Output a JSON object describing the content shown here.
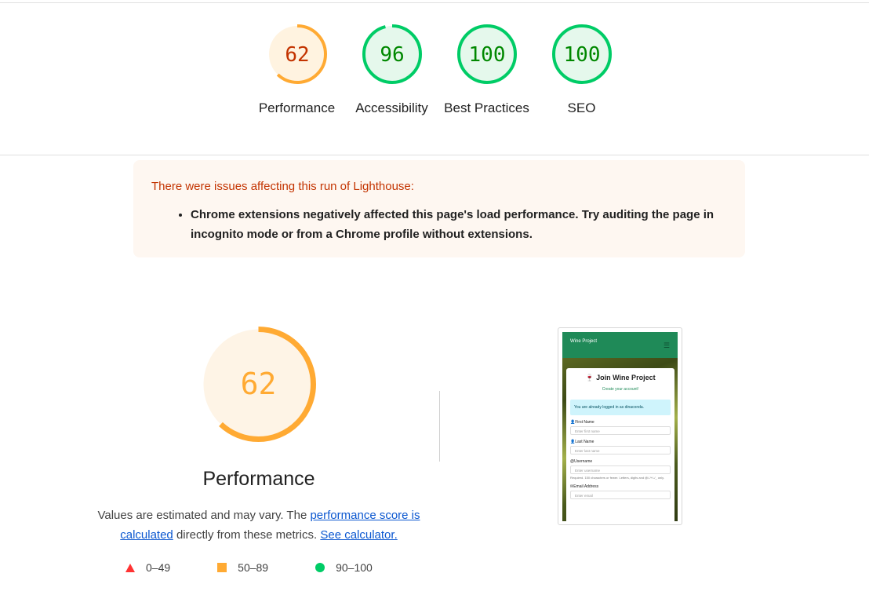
{
  "colors": {
    "average": "#fa3",
    "average_text": "#c33300",
    "pass": "#0c6",
    "pass_text": "#008800",
    "average_bg": "#fff3e0",
    "pass_bg": "#e5f8ec",
    "fail": "#f33"
  },
  "summary": {
    "gauges": [
      {
        "label": "Performance",
        "score": "62",
        "rating": "average",
        "value": 62
      },
      {
        "label": "Accessibility",
        "score": "96",
        "rating": "pass",
        "value": 96
      },
      {
        "label": "Best Practices",
        "score": "100",
        "rating": "pass",
        "value": 100
      },
      {
        "label": "SEO",
        "score": "100",
        "rating": "pass",
        "value": 100
      }
    ]
  },
  "warning": {
    "title": "There were issues affecting this run of Lighthouse:",
    "items": [
      "Chrome extensions negatively affected this page's load performance. Try auditing the page in incognito mode or from a Chrome profile without extensions."
    ]
  },
  "performance": {
    "score": "62",
    "value": 62,
    "title": "Performance",
    "explainer_prefix": "Values are estimated and may vary. The ",
    "link_score": "performance score is calculated",
    "explainer_middle": " directly from these metrics.",
    "link_calculator": "See calculator."
  },
  "legend": [
    {
      "shape": "triangle",
      "range": "0–49"
    },
    {
      "shape": "square",
      "range": "50–89"
    },
    {
      "shape": "circle",
      "range": "90–100"
    }
  ],
  "screenshot": {
    "logo": "Wine Project",
    "title": "Join Wine Project",
    "subtitle": "Create your account!",
    "alert": "You are already logged in as dinaconda.",
    "fields": [
      {
        "label": "First Name",
        "placeholder": "Enter first name"
      },
      {
        "label": "Last Name",
        "placeholder": "Enter last name"
      },
      {
        "label": "Username",
        "placeholder": "Enter username",
        "help": "Required. 150 characters or fewer. Letters, digits and @/./+/-/_ only."
      },
      {
        "label": "Email Address",
        "placeholder": "Enter email"
      }
    ]
  }
}
